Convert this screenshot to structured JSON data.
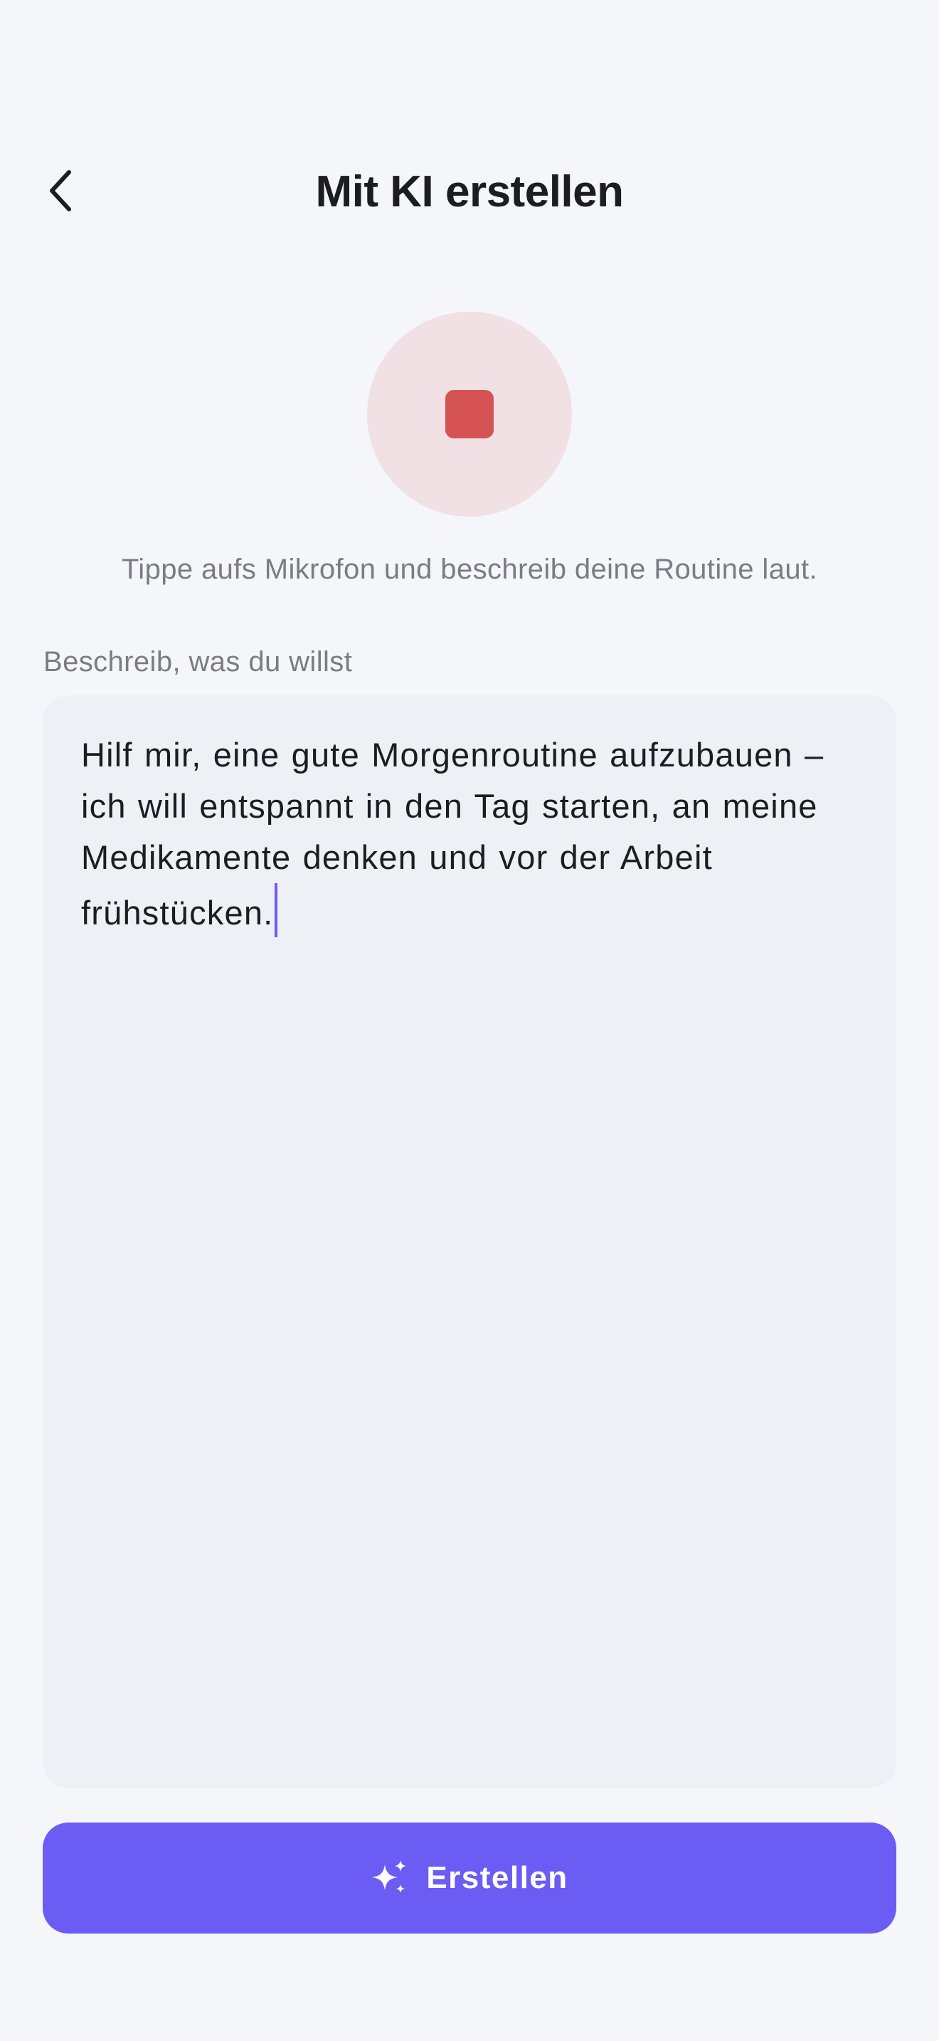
{
  "header": {
    "title": "Mit KI erstellen",
    "back_icon": "chevron-left-icon"
  },
  "voice": {
    "state": "recording",
    "icon": "stop-icon",
    "hint": "Tippe aufs Mikrofon und beschreib deine Routine laut."
  },
  "prompt": {
    "label": "Beschreib, was du willst",
    "value": "Hilf mir, eine gute Morgenroutine aufzubauen – ich will entspannt in den Tag starten, an meine Medikamente denken und vor der Arbeit frühstücken."
  },
  "actions": {
    "create_label": "Erstellen",
    "create_icon": "sparkle-icon"
  },
  "colors": {
    "accent": "#6b5cf4",
    "record_stop": "#d65353",
    "record_bg": "#f1e0e4",
    "background": "#f5f6fa"
  }
}
